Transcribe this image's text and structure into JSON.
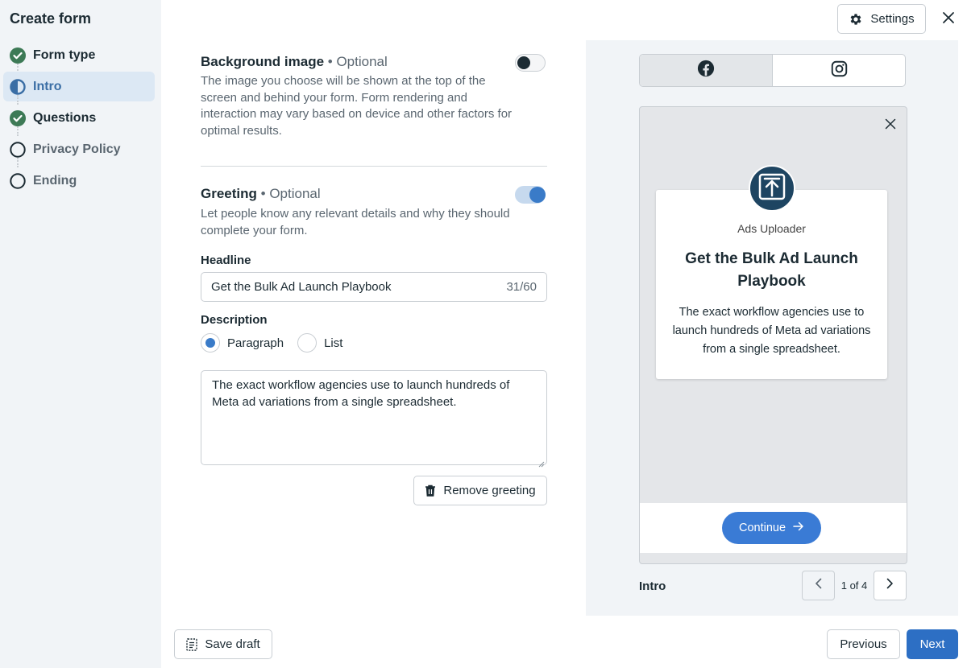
{
  "sidebar": {
    "title": "Create form",
    "steps": [
      {
        "label": "Form type",
        "status": "complete"
      },
      {
        "label": "Intro",
        "status": "active"
      },
      {
        "label": "Questions",
        "status": "complete"
      },
      {
        "label": "Privacy Policy",
        "status": "pending"
      },
      {
        "label": "Ending",
        "status": "pending"
      }
    ]
  },
  "header": {
    "settings_label": "Settings"
  },
  "background_image": {
    "title": "Background image",
    "optional": "• Optional",
    "description": "The image you choose will be shown at the top of the screen and behind your form. Form rendering and interaction may vary based on device and other factors for optimal results.",
    "enabled": false
  },
  "greeting": {
    "title": "Greeting",
    "optional": "• Optional",
    "description": "Let people know any relevant details and why they should complete your form.",
    "enabled": true,
    "headline_label": "Headline",
    "headline_value": "Get the Bulk Ad Launch Playbook",
    "headline_count": "31/60",
    "description_label": "Description",
    "format_options": [
      {
        "label": "Paragraph",
        "selected": true
      },
      {
        "label": "List",
        "selected": false
      }
    ],
    "description_value": "The exact workflow agencies use to launch hundreds of Meta ad variations from a single spreadsheet.",
    "remove_label": "Remove greeting"
  },
  "preview": {
    "platforms": [
      "facebook-icon",
      "instagram-icon"
    ],
    "brand_name": "Ads Uploader",
    "headline": "Get the Bulk Ad Launch Playbook",
    "description": "The exact workflow agencies use to launch hundreds of Meta ad variations from a single spreadsheet.",
    "continue_label": "Continue",
    "screen_label": "Intro",
    "page_indicator": "1 of 4"
  },
  "footer": {
    "save_draft_label": "Save draft",
    "previous_label": "Previous",
    "next_label": "Next"
  },
  "colors": {
    "complete": "#3d7a56",
    "active": "#3a6ea5",
    "primary": "#2d6fc4",
    "preview_button": "#3a7bd5"
  }
}
